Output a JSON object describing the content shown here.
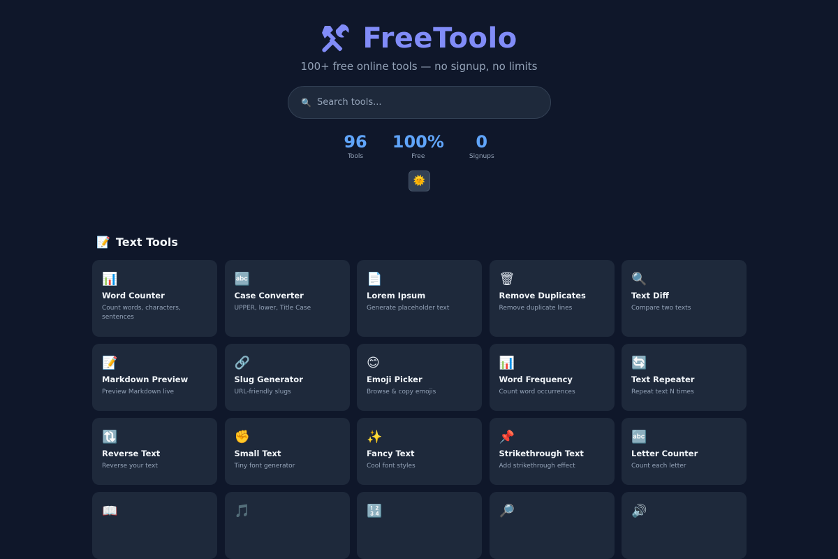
{
  "header": {
    "title": "FreeToolo",
    "tagline": "100+ free online tools — no signup, no limits",
    "search_placeholder": "Search tools...",
    "theme_icon": "sun-icon"
  },
  "stats": [
    {
      "value": "96",
      "label": "Tools"
    },
    {
      "value": "100%",
      "label": "Free"
    },
    {
      "value": "0",
      "label": "Signups"
    }
  ],
  "section": {
    "title": "Text Tools",
    "icon": "memo-icon"
  },
  "tools": [
    {
      "icon": "📊",
      "icon_name": "bar-chart-icon",
      "name": "Word Counter",
      "desc": "Count words, characters, sentences"
    },
    {
      "icon": "🔤",
      "icon_name": "abc-icon",
      "name": "Case Converter",
      "desc": "UPPER, lower, Title Case"
    },
    {
      "icon": "📄",
      "icon_name": "document-icon",
      "name": "Lorem Ipsum",
      "desc": "Generate placeholder text"
    },
    {
      "icon": "🗑",
      "icon_name": "trash-icon",
      "name": "Remove Duplicates",
      "desc": "Remove duplicate lines"
    },
    {
      "icon": "🔍",
      "icon_name": "magnifier-icon",
      "name": "Text Diff",
      "desc": "Compare two texts"
    },
    {
      "icon": "📝",
      "icon_name": "memo-icon",
      "name": "Markdown Preview",
      "desc": "Preview Markdown live"
    },
    {
      "icon": "🔗",
      "icon_name": "link-icon",
      "name": "Slug Generator",
      "desc": "URL-friendly slugs"
    },
    {
      "icon": "😊",
      "icon_name": "smiley-icon",
      "name": "Emoji Picker",
      "desc": "Browse & copy emojis"
    },
    {
      "icon": "📊",
      "icon_name": "bar-chart-icon",
      "name": "Word Frequency",
      "desc": "Count word occurrences"
    },
    {
      "icon": "🔄",
      "icon_name": "repeat-icon",
      "name": "Text Repeater",
      "desc": "Repeat text N times"
    },
    {
      "icon": "🔃",
      "icon_name": "reverse-icon",
      "name": "Reverse Text",
      "desc": "Reverse your text"
    },
    {
      "icon": "✊",
      "icon_name": "fist-icon",
      "name": "Small Text",
      "desc": "Tiny font generator"
    },
    {
      "icon": "✨",
      "icon_name": "sparkles-icon",
      "name": "Fancy Text",
      "desc": "Cool font styles"
    },
    {
      "icon": "📌",
      "icon_name": "pushpin-icon",
      "name": "Strikethrough Text",
      "desc": "Add strikethrough effect"
    },
    {
      "icon": "🔤",
      "icon_name": "abc-icon",
      "name": "Letter Counter",
      "desc": "Count each letter"
    },
    {
      "icon": "📖",
      "icon_name": "book-icon",
      "name": "",
      "desc": ""
    },
    {
      "icon": "🎵",
      "icon_name": "music-note-icon",
      "name": "",
      "desc": ""
    },
    {
      "icon": "🔢",
      "icon_name": "numbers-icon",
      "name": "",
      "desc": ""
    },
    {
      "icon": "🔎",
      "icon_name": "magnifier-right-icon",
      "name": "",
      "desc": ""
    },
    {
      "icon": "🔊",
      "icon_name": "speaker-icon",
      "name": "",
      "desc": ""
    }
  ],
  "colors": {
    "background": "#0f172a",
    "card": "#1e293b",
    "accent": "#818cf8",
    "stat": "#60a5fa"
  }
}
